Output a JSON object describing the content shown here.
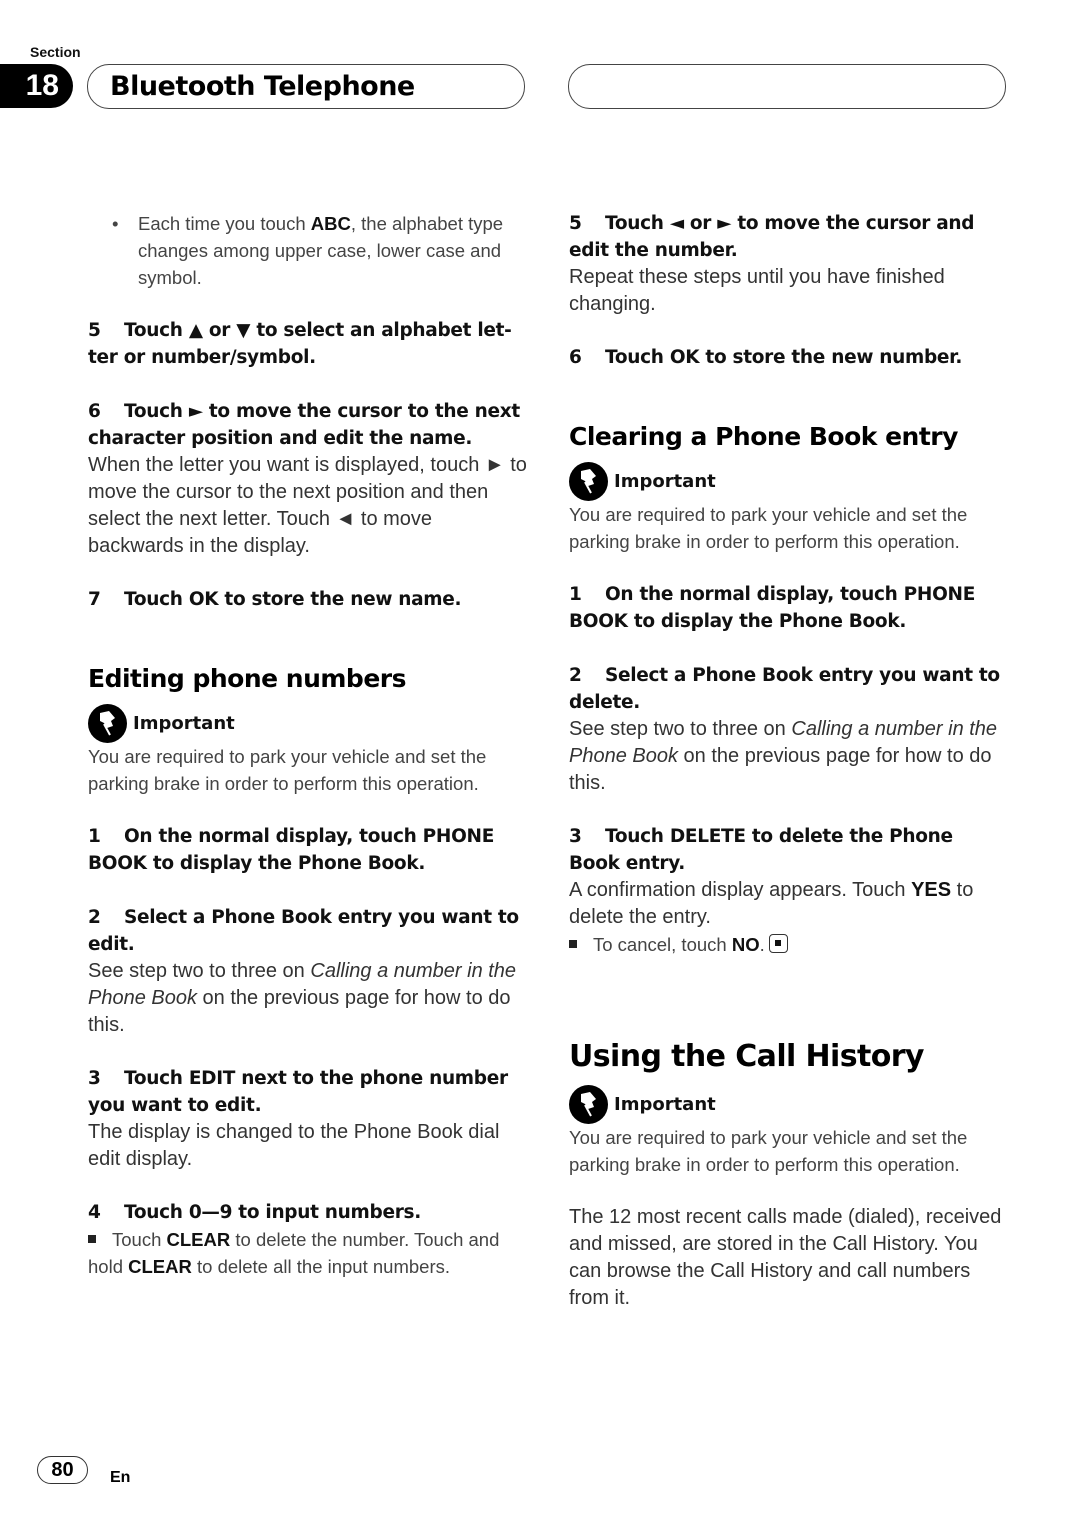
{
  "header": {
    "section_label": "Section",
    "section_number": "18",
    "title": "Bluetooth Telephone"
  },
  "left": {
    "bullet_abc": {
      "pre": "Each time you touch ",
      "bold": "ABC",
      "post": ", the alphabet type changes among upper case, lower case and symbol."
    },
    "step5": {
      "num": "5",
      "text": "Touch ▲ or ▼ to select an alphabet let­ter or number/symbol."
    },
    "step6": {
      "num": "6",
      "text": "Touch ► to move the cursor to the next character position and edit the name."
    },
    "step6_body": "When the letter you want is displayed, touch ► to move the cursor to the next position and then select the next letter. Touch ◄ to move backwards in the display.",
    "step7": {
      "num": "7",
      "text": "Touch OK to store the new name."
    },
    "editing_heading": "Editing phone numbers",
    "important_label": "Important",
    "important_text": "You are required to park your vehicle and set the parking brake in order to perform this operation.",
    "e_step1": {
      "num": "1",
      "text": "On the normal display, touch PHONE BOOK to display the Phone Book."
    },
    "e_step2": {
      "num": "2",
      "text": "Select a Phone Book entry you want to edit."
    },
    "e_step2_body": {
      "pre": "See step two to three on ",
      "italic": "Calling a number in the Phone Book",
      "post": " on the previous page for how to do this."
    },
    "e_step3": {
      "num": "3",
      "text": "Touch EDIT next to the phone number you want to edit."
    },
    "e_step3_body": "The display is changed to the Phone Book dial edit display.",
    "e_step4": {
      "num": "4",
      "text": "Touch 0—9 to input numbers."
    },
    "e_step4_note": {
      "t1": "Touch ",
      "b1": "CLEAR",
      "t2": " to delete the number. Touch and hold ",
      "b2": "CLEAR",
      "t3": " to delete all the input numbers."
    }
  },
  "right": {
    "step5": {
      "num": "5",
      "text": "Touch ◄ or ► to move the cursor and edit the number."
    },
    "step5_body": "Repeat these steps until you have finished changing.",
    "step6": {
      "num": "6",
      "text": "Touch OK to store the new number."
    },
    "clearing_heading": "Clearing a Phone Book entry",
    "important_label": "Important",
    "important_text": "You are required to park your vehicle and set the parking brake in order to perform this operation.",
    "c_step1": {
      "num": "1",
      "text": "On the normal display, touch PHONE BOOK to display the Phone Book."
    },
    "c_step2": {
      "num": "2",
      "text": "Select a Phone Book entry you want to delete."
    },
    "c_step2_body": {
      "pre": "See step two to three on ",
      "italic": "Calling a number in the Phone Book",
      "post": " on the previous page for how to do this."
    },
    "c_step3": {
      "num": "3",
      "text": "Touch DELETE to delete the Phone Book entry."
    },
    "c_step3_body": {
      "pre": "A confirmation display appears. Touch ",
      "bold": "YES",
      "post": " to delete the entry."
    },
    "c_step3_note": {
      "pre": "To cancel, touch ",
      "bold": "NO",
      "post": "."
    },
    "history_heading": "Using the Call History",
    "history_important_label": "Important",
    "history_important_text": "You are required to park your vehicle and set the parking brake in order to perform this operation.",
    "history_body": "The 12 most recent calls made (dialed), re­ceived and missed, are stored in the Call His­tory. You can browse the Call History and call numbers from it."
  },
  "footer": {
    "page_number": "80",
    "language": "En"
  }
}
